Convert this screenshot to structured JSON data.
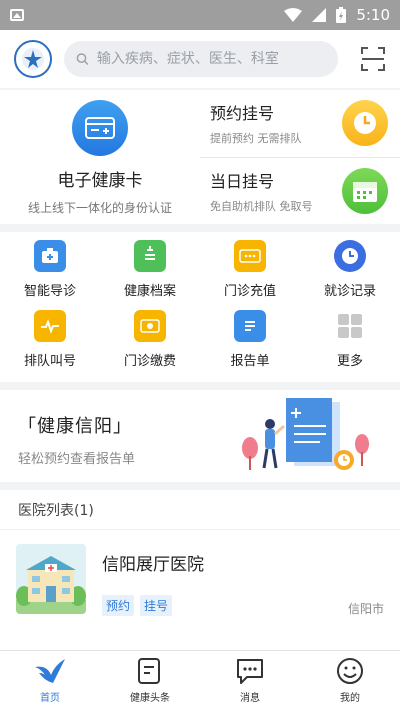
{
  "status_bar": {
    "time": "5:10"
  },
  "header": {
    "search_placeholder": "输入疾病、症状、医生、科室"
  },
  "health_card": {
    "title": "电子健康卡",
    "subtitle": "线上线下一体化的身份认证"
  },
  "quick_cards": [
    {
      "title": "预约挂号",
      "subtitle": "提前预约 无需排队"
    },
    {
      "title": "当日挂号",
      "subtitle": "免自助机排队 免取号"
    }
  ],
  "grid": [
    {
      "label": "智能导诊",
      "icon": "hospital-guide-icon",
      "color": "#3b8ee8"
    },
    {
      "label": "健康档案",
      "icon": "health-record-icon",
      "color": "#4fbf5a"
    },
    {
      "label": "门诊充值",
      "icon": "recharge-icon",
      "color": "#f7b500"
    },
    {
      "label": "就诊记录",
      "icon": "clock-icon",
      "color": "#3b6ee0"
    },
    {
      "label": "排队叫号",
      "icon": "queue-monitor-icon",
      "color": "#f7b500"
    },
    {
      "label": "门诊缴费",
      "icon": "payment-icon",
      "color": "#f7b500"
    },
    {
      "label": "报告单",
      "icon": "report-icon",
      "color": "#3b8ee8"
    },
    {
      "label": "更多",
      "icon": "more-grid-icon",
      "color": "#c8c8c8"
    }
  ],
  "banner": {
    "title": "「健康信阳」",
    "subtitle": "轻松预约查看报告单"
  },
  "hospital_list": {
    "title": "医院列表(1)",
    "items": [
      {
        "name": "信阳展厅医院",
        "tags": [
          "预约",
          "挂号"
        ],
        "city": "信阳市"
      }
    ]
  },
  "tabs": [
    {
      "label": "首页",
      "active": true
    },
    {
      "label": "健康头条",
      "active": false
    },
    {
      "label": "消息",
      "active": false
    },
    {
      "label": "我的",
      "active": false
    }
  ]
}
